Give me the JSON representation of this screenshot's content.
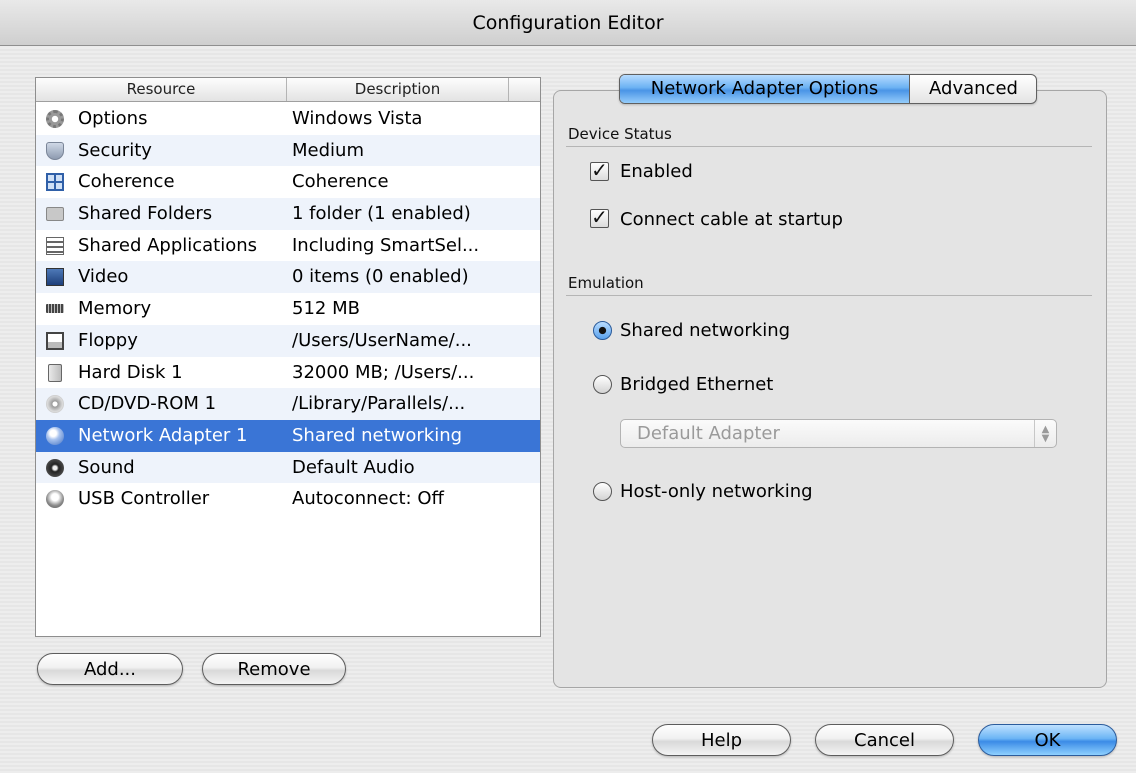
{
  "window": {
    "title": "Configuration Editor"
  },
  "list": {
    "columns": [
      "Resource",
      "Description"
    ],
    "rows": [
      {
        "name": "Options",
        "desc": "Windows Vista",
        "icon": "gear-icon"
      },
      {
        "name": "Security",
        "desc": "Medium",
        "icon": "shield-icon"
      },
      {
        "name": "Coherence",
        "desc": "Coherence",
        "icon": "coherence-icon"
      },
      {
        "name": "Shared Folders",
        "desc": "1 folder (1 enabled)",
        "icon": "folder-icon"
      },
      {
        "name": "Shared Applications",
        "desc": "Including SmartSel...",
        "icon": "applications-icon"
      },
      {
        "name": "Video",
        "desc": "0 items (0 enabled)",
        "icon": "monitor-icon"
      },
      {
        "name": "Memory",
        "desc": "512 MB",
        "icon": "memory-chip-icon"
      },
      {
        "name": "Floppy",
        "desc": "/Users/UserName/...",
        "icon": "floppy-icon"
      },
      {
        "name": "Hard Disk 1",
        "desc": "32000 MB; /Users/...",
        "icon": "hard-disk-icon"
      },
      {
        "name": "CD/DVD-ROM 1",
        "desc": "/Library/Parallels/...",
        "icon": "cd-icon"
      },
      {
        "name": "Network Adapter 1",
        "desc": "Shared networking",
        "icon": "network-icon"
      },
      {
        "name": "Sound",
        "desc": "Default Audio",
        "icon": "speaker-icon"
      },
      {
        "name": "USB Controller",
        "desc": "Autoconnect: Off",
        "icon": "usb-icon"
      }
    ],
    "selected_index": 10
  },
  "buttons": {
    "add": "Add...",
    "remove": "Remove",
    "help": "Help",
    "cancel": "Cancel",
    "ok": "OK"
  },
  "tabs": {
    "active": "Network Adapter Options",
    "inactive": "Advanced"
  },
  "device_status": {
    "heading": "Device Status",
    "enabled_label": "Enabled",
    "enabled": true,
    "connect_label": "Connect cable at startup",
    "connect": true
  },
  "emulation": {
    "heading": "Emulation",
    "shared": "Shared networking",
    "bridged": "Bridged Ethernet",
    "host_only": "Host-only networking",
    "selected": "Shared networking",
    "adapter_select": "Default Adapter"
  },
  "colors": {
    "selection": "#3a75d6",
    "accent": "#4a94e6"
  }
}
